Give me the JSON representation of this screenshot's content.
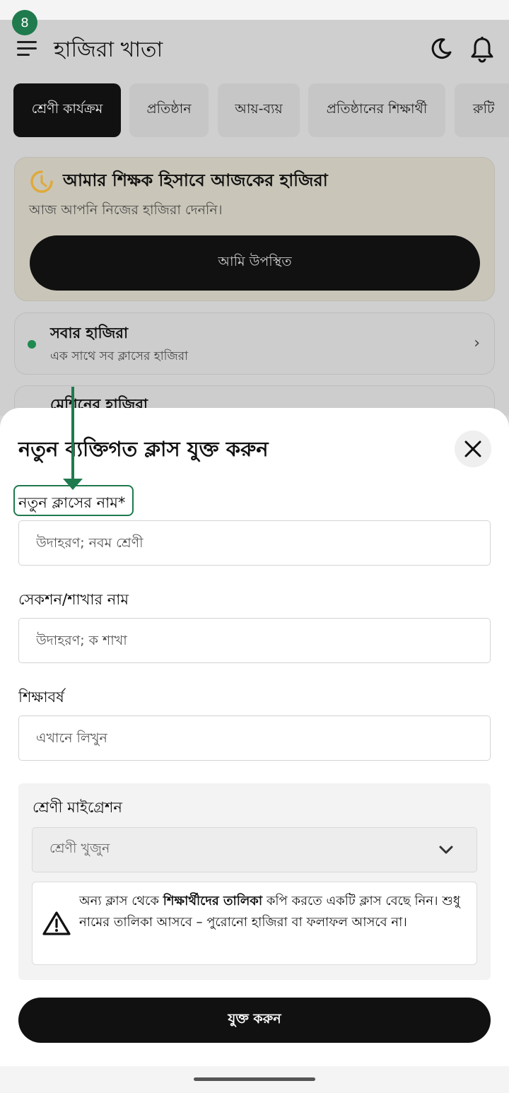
{
  "step_badge": "8",
  "header": {
    "title": "হাজিরা খাতা",
    "icons": [
      "menu-icon",
      "moon-icon",
      "bell-icon"
    ]
  },
  "tabs": [
    {
      "label": "শ্রেণী কার্যক্রম",
      "active": true
    },
    {
      "label": "প্রতিষ্ঠান",
      "active": false
    },
    {
      "label": "আয়-ব্যয়",
      "active": false
    },
    {
      "label": "প্রতিষ্ঠানের শিক্ষার্থী",
      "active": false
    },
    {
      "label": "রুটি",
      "active": false
    }
  ],
  "attendance_card": {
    "title": "আমার শিক্ষক হিসাবে আজকের হাজিরা",
    "subtitle": "আজ আপনি নিজের হাজিরা দেননি।",
    "button": "আমি উপস্থিত"
  },
  "all_attendance": {
    "title": "সবার হাজিরা",
    "subtitle": "এক সাথে সব ক্লাসের হাজিরা",
    "chevron": "›"
  },
  "machine_attendance": {
    "title": "মেশিনের হাজিরা"
  },
  "sheet": {
    "title": "নতুন ব্যক্তিগত ক্লাস যুক্ত করুন",
    "class_name": {
      "label": "নতুন ক্লাসের নাম*",
      "placeholder": "উদাহরণ; নবম শ্রেণী"
    },
    "section_name": {
      "label": "সেকশন/শাখার নাম",
      "placeholder": "উদাহরণ; ক শাখা"
    },
    "academic_year": {
      "label": "শিক্ষাবর্ষ",
      "placeholder": "এখানে লিখুন"
    },
    "migration": {
      "label": "শ্রেণী মাইগ্রেশন",
      "select_placeholder": "শ্রেণী খুজুন",
      "warning_pre": "অন্য ক্লাস থেকে ",
      "warning_bold": "শিক্ষার্থীদের তালিকা",
      "warning_post": " কপি করতে একটি ক্লাস বেছে নিন। শুধু নামের তালিকা আসবে – পুরোনো হাজিরা বা ফলাফল আসবে না।"
    },
    "submit": "যুক্ত করুন"
  },
  "colors": {
    "accent_green": "#1f7a4d",
    "primary_dark": "#111111",
    "clock_orange": "#e0a93a"
  }
}
